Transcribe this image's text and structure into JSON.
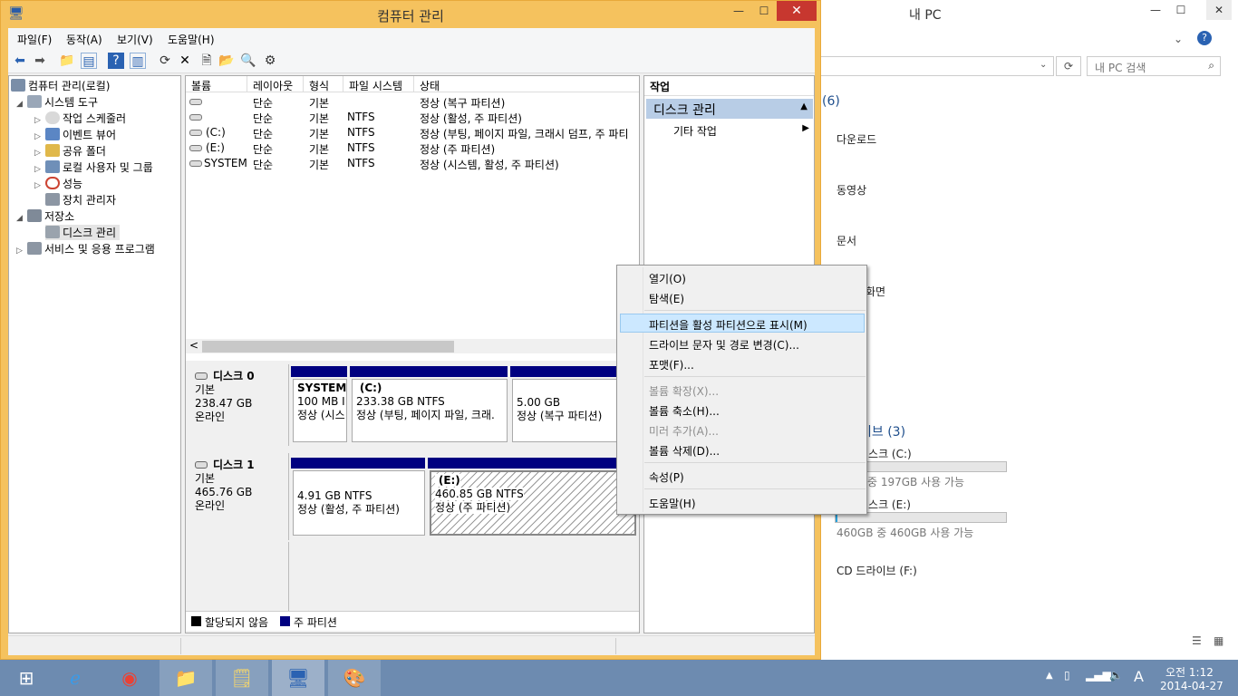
{
  "bg_window": {
    "title": "내 PC",
    "search_placeholder": "내 PC 검색",
    "folders_group": "(6)",
    "folders": [
      "다운로드",
      "동영상",
      "문서",
      "화면"
    ],
    "drives_group": "이브 (3)",
    "drive_c_label": "디스크 (C:)",
    "drive_c_space": "중 197GB 사용 가능",
    "drive_c_fill": 0.15,
    "drive_e_label": "디스크 (E:)",
    "drive_e_space": "460GB 중 460GB 사용 가능",
    "drive_e_fill": 0.01,
    "cd_label": "CD 드라이브 (F:)"
  },
  "window": {
    "title": "컴퓨터 관리",
    "minimize": "🗕",
    "maximize": "🗖",
    "close": "✕"
  },
  "menu": {
    "file": "파일(F)",
    "action": "동작(A)",
    "view": "보기(V)",
    "help": "도움말(H)"
  },
  "tree": {
    "root": "컴퓨터 관리(로컬)",
    "system_tools": "시스템 도구",
    "task_scheduler": "작업 스케줄러",
    "event_viewer": "이벤트 뷰어",
    "shared_folders": "공유 폴더",
    "local_users": "로컬 사용자 및 그룹",
    "performance": "성능",
    "device_manager": "장치 관리자",
    "storage": "저장소",
    "disk_management": "디스크 관리",
    "services": "서비스 및 응용 프로그램"
  },
  "volume_list": {
    "headers": [
      "볼륨",
      "레이아웃",
      "형식",
      "파일 시스템",
      "상태"
    ],
    "rows": [
      [
        "",
        "단순",
        "기본",
        "",
        "정상 (복구 파티션)"
      ],
      [
        "",
        "단순",
        "기본",
        "NTFS",
        "정상 (활성, 주 파티션)"
      ],
      [
        "(C:)",
        "단순",
        "기본",
        "NTFS",
        "정상 (부팅, 페이지 파일, 크래시 덤프, 주 파티"
      ],
      [
        "(E:)",
        "단순",
        "기본",
        "NTFS",
        "정상 (주 파티션)"
      ],
      [
        "SYSTEM",
        "단순",
        "기본",
        "NTFS",
        "정상 (시스템, 활성, 주 파티션)"
      ]
    ],
    "scroll_left": "<"
  },
  "disks": {
    "disk0": {
      "name": "디스크 0",
      "type": "기본",
      "size": "238.47 GB",
      "status": "온라인"
    },
    "disk1": {
      "name": "디스크 1",
      "type": "기본",
      "size": "465.76 GB",
      "status": "온라인"
    },
    "d0p1": {
      "name": "SYSTEM",
      "size": "100 MB I",
      "status": "정상 (시스"
    },
    "d0p2": {
      "name": "(C:)",
      "size": "233.38 GB NTFS",
      "status": "정상 (부팅, 페이지 파일, 크래."
    },
    "d0p3": {
      "size": "5.00 GB",
      "status": "정상 (복구 파티션)"
    },
    "d1p1": {
      "size": "4.91 GB NTFS",
      "status": "정상 (활성, 주 파티션)"
    },
    "d1p2": {
      "name": "(E:)",
      "size": "460.85 GB NTFS",
      "status": "정상 (주 파티션)"
    }
  },
  "legend": {
    "unallocated": "할당되지 않음",
    "primary": "주 파티션",
    "unallocated_color": "#000000",
    "primary_color": "#000080"
  },
  "actions": {
    "header": "작업",
    "section": "디스크 관리",
    "more": "기타 작업"
  },
  "context_menu": {
    "open": "열기(O)",
    "explore": "탐색(E)",
    "mark_active": "파티션을 활성 파티션으로 표시(M)",
    "change_letter": "드라이브 문자 및 경로 변경(C)...",
    "format": "포맷(F)...",
    "extend": "볼륨 확장(X)...",
    "shrink": "볼륨 축소(H)...",
    "add_mirror": "미러 추가(A)...",
    "delete": "볼륨 삭제(D)...",
    "properties": "속성(P)",
    "help": "도움말(H)"
  },
  "taskbar": {
    "ime": "A",
    "time": "오전 1:12",
    "date": "2014-04-27"
  }
}
